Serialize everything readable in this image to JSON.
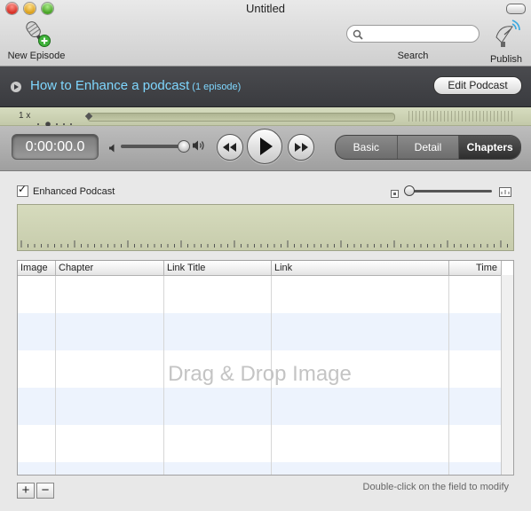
{
  "window": {
    "title": "Untitled"
  },
  "toolbar": {
    "new_episode_label": "New Episode",
    "search_label": "Search",
    "search_placeholder": "",
    "publish_label": "Publish"
  },
  "podcast": {
    "title": "How to Enhance a  podcast",
    "episode_count": "(1 episode)",
    "edit_button": "Edit Podcast"
  },
  "timeline": {
    "speed": "1 x",
    "progress_fraction": 0.0
  },
  "transport": {
    "time": "0:00:00.0",
    "volume_fraction": 0.9,
    "segments": [
      {
        "label": "Basic",
        "active": false
      },
      {
        "label": "Detail",
        "active": false
      },
      {
        "label": "Chapters",
        "active": true
      }
    ]
  },
  "content": {
    "enhanced_label": "Enhanced Podcast",
    "enhanced_checked": true,
    "zoom_fraction": 0.0
  },
  "table": {
    "columns": [
      "Image",
      "Chapter",
      "Link Title",
      "Link",
      "Time"
    ],
    "rows": [],
    "drop_hint": "Drag & Drop Image",
    "stripe_colors": [
      "#ffffff",
      "#edf3fd"
    ]
  },
  "footer": {
    "add_label": "+",
    "remove_label": "−",
    "hint": "Double-click on the field to modify"
  },
  "colors": {
    "accent_title": "#7fd7ff",
    "active_segment": "#2e2e2e",
    "waveform_bg": "#d0d5b4"
  }
}
